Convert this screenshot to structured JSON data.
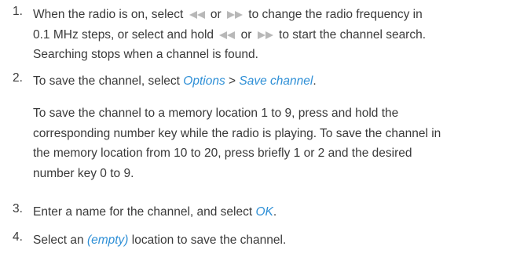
{
  "steps": [
    {
      "number": "1.",
      "lines": [
        {
          "a": "When the radio is on, select ",
          "or": " or ",
          "b": " to change the radio frequency in"
        },
        {
          "a": "0.1 MHz steps, or select and hold ",
          "or": " or ",
          "b": " to start the channel search."
        },
        {
          "a": "Searching stops when a channel is found."
        }
      ]
    },
    {
      "number": "2.",
      "pre": "To save the channel, select ",
      "options": "Options",
      "sep": " > ",
      "save_channel": "Save channel",
      "post": "."
    },
    {
      "lines": [
        "To save the channel to a memory location 1 to 9, press and hold the",
        "corresponding number key while the radio is playing. To save the channel in",
        "the memory location from 10 to 20, press briefly 1 or 2 and the desired",
        "number key 0 to 9."
      ]
    },
    {
      "number": "3.",
      "pre": "Enter a name for the channel, and select ",
      "ok": "OK",
      "post": "."
    },
    {
      "number": "4.",
      "pre": "Select an ",
      "empty": "(empty)",
      "post": " location to save the channel."
    }
  ],
  "icons": {
    "back": "rewind-icon",
    "forward": "fast-forward-icon",
    "color": "#b8b8b8"
  },
  "colors": {
    "text": "#3a3a3a",
    "emphasis": "#2e8fd6"
  }
}
